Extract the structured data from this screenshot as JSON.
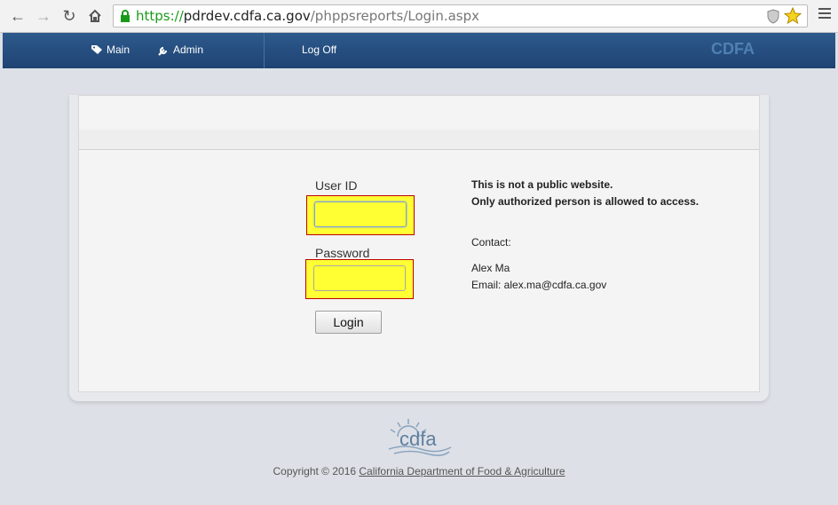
{
  "browser": {
    "url_scheme": "https://",
    "url_host": "pdrdev.cdfa.ca.gov",
    "url_path": "/phppsreports/Login.aspx"
  },
  "nav": {
    "main_label": "Main",
    "admin_label": "Admin",
    "logoff_label": "Log Off",
    "brand": "CDFA"
  },
  "login": {
    "userid_label": "User ID",
    "userid_value": "",
    "password_label": "Password",
    "password_value": "",
    "login_button": "Login"
  },
  "notice": {
    "line1": "This is not a public website.",
    "line2": "Only authorized person is allowed to access.",
    "contact_label": "Contact:",
    "contact_name": "Alex Ma",
    "contact_email": "Email: alex.ma@cdfa.ca.gov"
  },
  "footer": {
    "logo_text": "cdfa",
    "copyright": "Copyright © 2016",
    "link_text": "California Department of Food & Agriculture"
  },
  "colors": {
    "navbar": "#1e4373",
    "highlight": "#ffff33",
    "highlight_border": "#c00000"
  }
}
